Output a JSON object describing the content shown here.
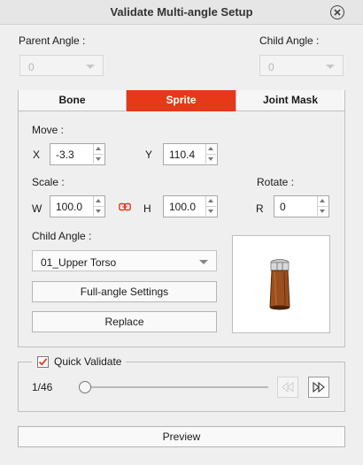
{
  "window": {
    "title": "Validate Multi-angle Setup"
  },
  "parent_angle": {
    "label": "Parent Angle :",
    "value": "0"
  },
  "child_angle_top": {
    "label": "Child Angle :",
    "value": "0"
  },
  "tabs": [
    {
      "label": "Bone"
    },
    {
      "label": "Sprite",
      "active": true
    },
    {
      "label": "Joint Mask"
    }
  ],
  "move": {
    "label": "Move :",
    "x_label": "X",
    "x_value": "-3.3",
    "y_label": "Y",
    "y_value": "110.4"
  },
  "scale": {
    "label": "Scale :",
    "w_label": "W",
    "w_value": "100.0",
    "h_label": "H",
    "h_value": "100.0"
  },
  "rotate": {
    "label": "Rotate :",
    "r_label": "R",
    "r_value": "0"
  },
  "child_angle": {
    "label": "Child Angle :",
    "value": "01_Upper Torso"
  },
  "buttons": {
    "full_angle": "Full-angle Settings",
    "replace": "Replace",
    "preview": "Preview"
  },
  "quick_validate": {
    "label": "Quick Validate",
    "checked": true,
    "frame": "1/46"
  },
  "colors": {
    "accent": "#e5391a",
    "check": "#e5391a",
    "link_icon": "#e5391a",
    "sprite_wood": "#9b4e1e"
  }
}
